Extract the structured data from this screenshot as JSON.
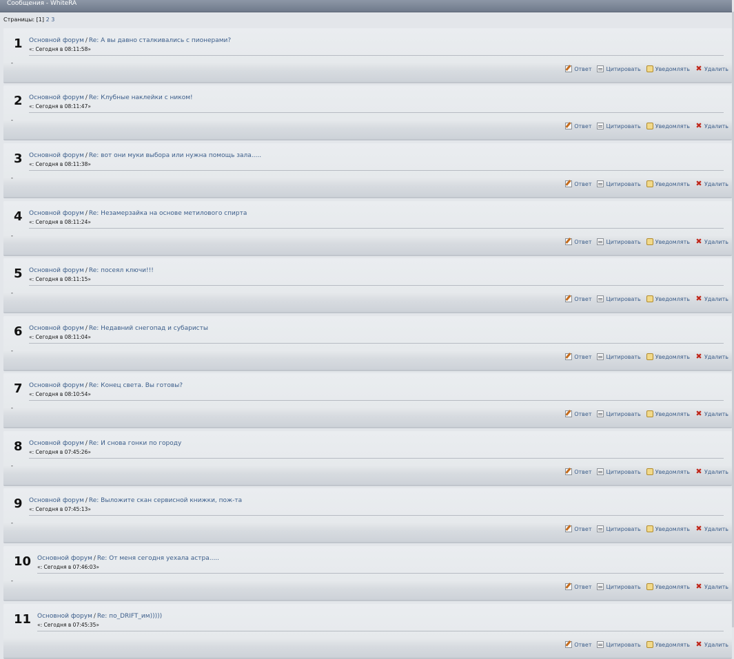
{
  "header": {
    "title": "Сообщения - WhiteRA"
  },
  "pager": {
    "label": "Страницы:",
    "current": "[1]",
    "pages": [
      "2",
      "3"
    ]
  },
  "actions": {
    "reply": "Ответ",
    "quote": "Цитировать",
    "notify": "Уведомлять",
    "delete": "Удалить"
  },
  "posts": [
    {
      "num": "1",
      "board": "Основной форум",
      "sep": "/",
      "subject": "Re: А вы давно сталкивались с пионерами?",
      "meta": "«: Сегодня в 08:11:58»",
      "body": "-"
    },
    {
      "num": "2",
      "board": "Основной форум",
      "sep": "/",
      "subject": "Re: Клубные наклейки с ником!",
      "meta": "«: Сегодня в 08:11:47»",
      "body": "-"
    },
    {
      "num": "3",
      "board": "Основной форум",
      "sep": "/",
      "subject": "Re: вот они муки выбора или нужна помощь зала.....",
      "meta": "«: Сегодня в 08:11:38»",
      "body": "-"
    },
    {
      "num": "4",
      "board": "Основной форум",
      "sep": "/",
      "subject": "Re: Незамерзайка на основе метилового спирта",
      "meta": "«: Сегодня в 08:11:24»",
      "body": "-"
    },
    {
      "num": "5",
      "board": "Основной форум",
      "sep": "/",
      "subject": "Re: посеял ключи!!!",
      "meta": "«: Сегодня в 08:11:15»",
      "body": "-"
    },
    {
      "num": "6",
      "board": "Основной форум",
      "sep": "/",
      "subject": "Re: Недавний снегопад и субаристы",
      "meta": "«: Сегодня в 08:11:04»",
      "body": "-"
    },
    {
      "num": "7",
      "board": "Основной форум",
      "sep": "/",
      "subject": "Re: Конец света. Вы готовы?",
      "meta": "«: Сегодня в 08:10:54»",
      "body": "-"
    },
    {
      "num": "8",
      "board": "Основной форум",
      "sep": "/",
      "subject": "Re: И снова гонки по городу",
      "meta": "«: Сегодня в 07:45:26»",
      "body": "-"
    },
    {
      "num": "9",
      "board": "Основной форум",
      "sep": "/",
      "subject": "Re: Выложите скан сервисной книжки, пож-та",
      "meta": "«: Сегодня в 07:45:13»",
      "body": "-"
    },
    {
      "num": "10",
      "board": "Основной форум",
      "sep": "/",
      "subject": "Re: От меня сегодня уехала астра.....",
      "meta": "«: Сегодня в 07:46:03»",
      "body": "-"
    },
    {
      "num": "11",
      "board": "Основной форум",
      "sep": "/",
      "subject": "Re: по_DRIFT_им)))))",
      "meta": "«: Сегодня в 07:45:35»",
      "body": ""
    }
  ]
}
